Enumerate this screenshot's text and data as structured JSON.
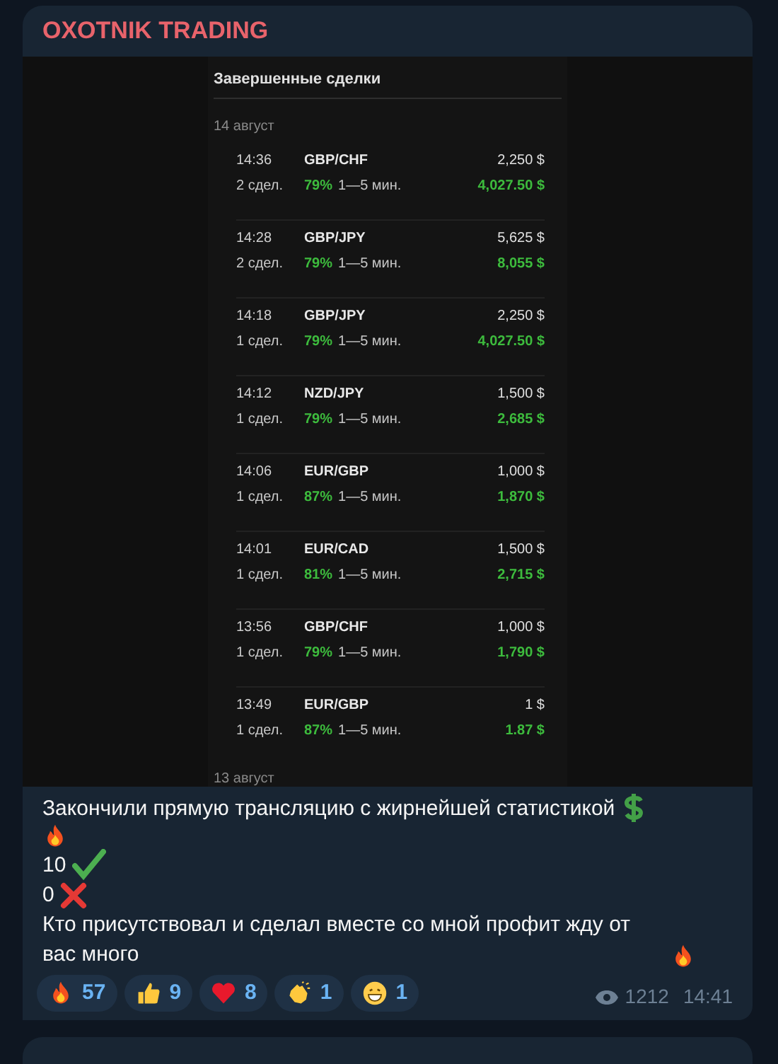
{
  "channel": {
    "title": "OXOTNIK TRADING"
  },
  "screenshot": {
    "title": "Завершенные сделки",
    "date": "14 август",
    "next_date": "13 август",
    "trades": [
      {
        "time": "14:36",
        "pair": "GBP/CHF",
        "amount": "2,250 $",
        "count": "2 сдел.",
        "percent": "79%",
        "duration": "1—5 мин.",
        "payout": "4,027.50 $"
      },
      {
        "time": "14:28",
        "pair": "GBP/JPY",
        "amount": "5,625 $",
        "count": "2 сдел.",
        "percent": "79%",
        "duration": "1—5 мин.",
        "payout": "8,055 $"
      },
      {
        "time": "14:18",
        "pair": "GBP/JPY",
        "amount": "2,250 $",
        "count": "1 сдел.",
        "percent": "79%",
        "duration": "1—5 мин.",
        "payout": "4,027.50 $"
      },
      {
        "time": "14:12",
        "pair": "NZD/JPY",
        "amount": "1,500 $",
        "count": "1 сдел.",
        "percent": "79%",
        "duration": "1—5 мин.",
        "payout": "2,685 $"
      },
      {
        "time": "14:06",
        "pair": "EUR/GBP",
        "amount": "1,000 $",
        "count": "1 сдел.",
        "percent": "87%",
        "duration": "1—5 мин.",
        "payout": "1,870 $"
      },
      {
        "time": "14:01",
        "pair": "EUR/CAD",
        "amount": "1,500 $",
        "count": "1 сдел.",
        "percent": "81%",
        "duration": "1—5 мин.",
        "payout": "2,715 $"
      },
      {
        "time": "13:56",
        "pair": "GBP/CHF",
        "amount": "1,000 $",
        "count": "1 сдел.",
        "percent": "79%",
        "duration": "1—5 мин.",
        "payout": "1,790 $"
      },
      {
        "time": "13:49",
        "pair": "EUR/GBP",
        "amount": "1 $",
        "count": "1 сдел.",
        "percent": "87%",
        "duration": "1—5 мин.",
        "payout": "1.87 $"
      }
    ]
  },
  "message": {
    "lines": [
      {
        "text": "Закончили прямую трансляцию с жирнейшей статистикой",
        "kind": "dollar"
      },
      {
        "kind": "fire"
      },
      {
        "text": "10",
        "kind": "check"
      },
      {
        "text": "0",
        "kind": "cross"
      },
      {
        "text": "Кто присутствовал и сделал вместе со мной профит жду от вас много",
        "kind": "fire"
      }
    ],
    "reactions": [
      {
        "kind": "fire",
        "count": "57"
      },
      {
        "kind": "thumbs",
        "count": "9"
      },
      {
        "kind": "heart",
        "count": "8"
      },
      {
        "kind": "clap",
        "count": "1"
      },
      {
        "kind": "grin",
        "count": "1"
      }
    ],
    "views": "1212",
    "time": "14:41"
  }
}
